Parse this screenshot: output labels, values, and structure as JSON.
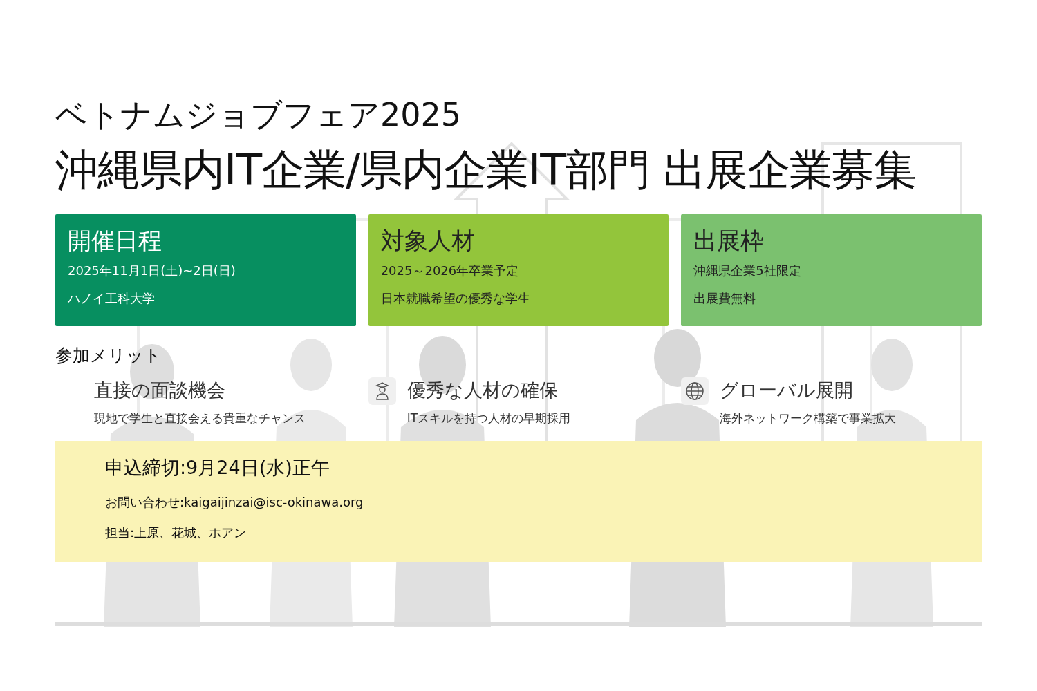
{
  "event_label": "ベトナムジョブフェア2025",
  "headline": "沖縄県内IT企業/県内企業IT部門 出展企業募集",
  "info_cards": [
    {
      "title": "開催日程",
      "lines": [
        "2025年11月1日(土)~2日(日)",
        "ハノイ工科大学"
      ],
      "color": "#078f60"
    },
    {
      "title": "対象人材",
      "lines": [
        "2025～2026年卒業予定",
        "日本就職希望の優秀な学生"
      ],
      "color": "#93c53b"
    },
    {
      "title": "出展枠",
      "lines": [
        "沖縄県企業5社限定",
        "出展費無料"
      ],
      "color": "#7bc16f"
    }
  ],
  "benefits_heading": "参加メリット",
  "benefits": [
    {
      "kind": "plain",
      "title": "直接の面談機会",
      "description": "現地で学生と直接会える貴重なチャンス"
    },
    {
      "kind": "person",
      "title": "優秀な人材の確保",
      "description": "ITスキルを持つ人材の早期採用"
    },
    {
      "kind": "globe",
      "title": "グローバル展開",
      "description": "海外ネットワーク構築で事業拡大"
    }
  ],
  "deadline": {
    "title": "申込締切:9月24日(水)正午",
    "contact": "お問い合わせ:kaigaijinzai@isc-okinawa.org",
    "staff": "担当:上原、花城、ホアン"
  }
}
